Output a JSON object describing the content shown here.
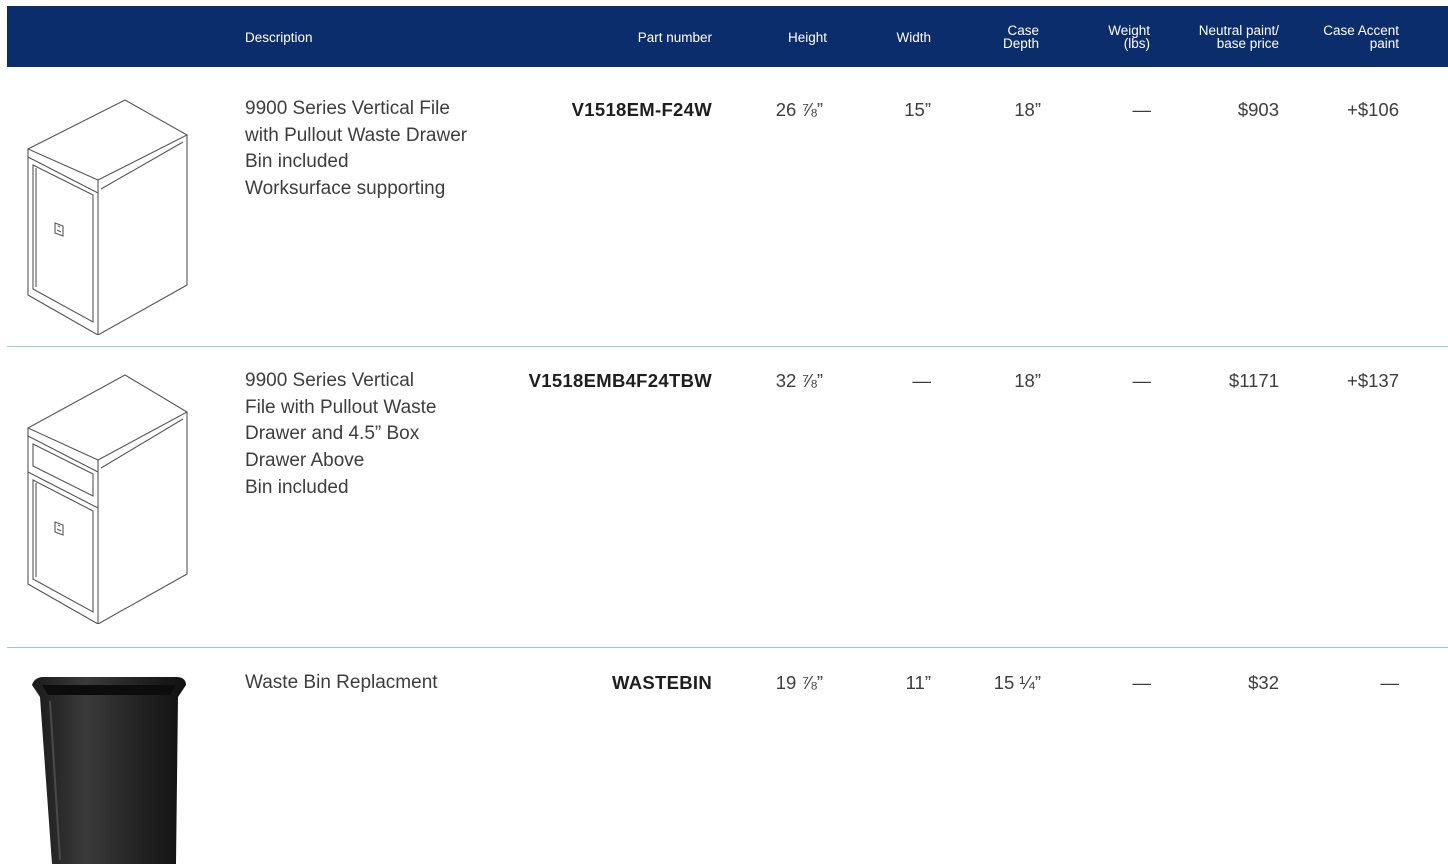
{
  "header": {
    "description": "Description",
    "part_number": "Part number",
    "height": "Height",
    "width": "Width",
    "case_depth_line1": "Case",
    "case_depth_line2": "Depth",
    "weight_line1": "Weight",
    "weight_line2": "(lbs)",
    "neutral_line1": "Neutral paint/",
    "neutral_line2": "base price",
    "accent_line1": "Case Accent",
    "accent_line2": "paint"
  },
  "colors": {
    "header_bg": "#0c2d6b",
    "divider": "#8fd0cb",
    "text": "#3d3d3d"
  },
  "rows": [
    {
      "image_icon": "vertical-file-cabinet-icon",
      "description_lines": [
        "9900 Series Vertical File",
        "with Pullout Waste Drawer",
        "Bin included",
        "Worksurface supporting"
      ],
      "part_number": "V1518EM-F24W",
      "height": "26 ⅞”",
      "width": "15”",
      "case_depth": "18”",
      "weight": "—",
      "neutral_price": "$903",
      "accent_price": "+$106"
    },
    {
      "image_icon": "vertical-file-with-box-drawer-icon",
      "description_lines": [
        "9900 Series Vertical",
        "File with Pullout Waste",
        "Drawer and 4.5” Box",
        "Drawer Above",
        "Bin included"
      ],
      "part_number": "V1518EMB4F24TBW",
      "height": "32 ⅞”",
      "width": "—",
      "case_depth": "18”",
      "weight": "—",
      "neutral_price": "$1171",
      "accent_price": "+$137"
    },
    {
      "image_icon": "waste-bin-icon",
      "description_lines": [
        "Waste Bin Replacment"
      ],
      "part_number": "WASTEBIN",
      "height": "19 ⅞”",
      "width": "11”",
      "case_depth": "15 ¼”",
      "weight": "—",
      "neutral_price": "$32",
      "accent_price": "—"
    }
  ]
}
